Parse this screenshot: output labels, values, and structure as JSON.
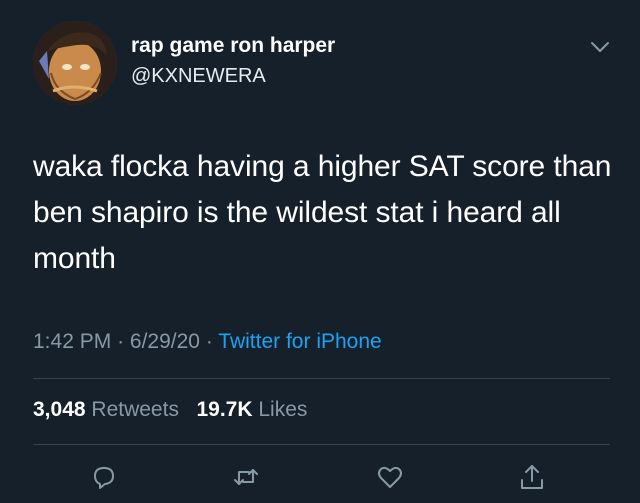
{
  "author": {
    "display_name": "rap game ron harper",
    "handle": "@KXNEWERA",
    "avatar_icon": "anime-character-avatar"
  },
  "tweet": {
    "text": "waka flocka having a higher SAT score than ben shapiro is the wildest stat i heard all month"
  },
  "meta": {
    "time": "1:42 PM",
    "separator": "·",
    "date": "6/29/20",
    "source": "Twitter for iPhone"
  },
  "stats": {
    "retweets_count": "3,048",
    "retweets_label": "Retweets",
    "likes_count": "19.7K",
    "likes_label": "Likes"
  },
  "actions": {
    "icons": [
      "reply-icon",
      "retweet-icon",
      "like-icon",
      "share-icon"
    ]
  },
  "colors": {
    "background": "#15202b",
    "text_primary": "#ffffff",
    "text_secondary": "#8899a6",
    "link": "#1da1f2",
    "divider": "#38444d"
  }
}
